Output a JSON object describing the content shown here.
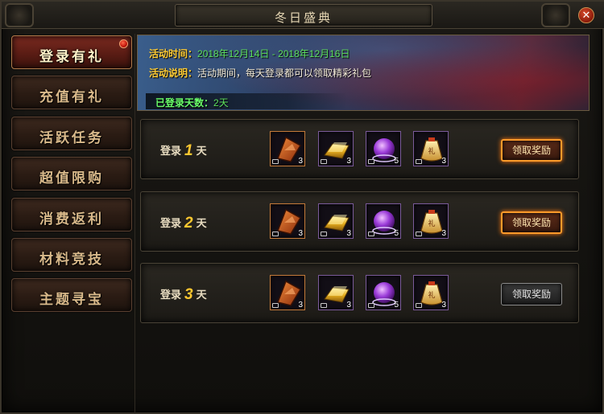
{
  "window": {
    "title": "冬日盛典"
  },
  "sidebar": {
    "items": [
      {
        "label": "登录有礼",
        "active": true,
        "badge": true
      },
      {
        "label": "充值有礼",
        "active": false
      },
      {
        "label": "活跃任务",
        "active": false
      },
      {
        "label": "超值限购",
        "active": false
      },
      {
        "label": "消费返利",
        "active": false
      },
      {
        "label": "材料竞技",
        "active": false
      },
      {
        "label": "主题寻宝",
        "active": false
      }
    ]
  },
  "banner": {
    "time_label": "活动时间：",
    "time_value": "2018年12月14日 - 2018年12月16日",
    "desc_label": "活动说明：",
    "desc_value": "活动期间，每天登录都可以领取精彩礼包",
    "days_label": "已登录天数：",
    "days_value": "2天"
  },
  "rewards": [
    {
      "prefix": "登录",
      "day": "1",
      "suffix": "天",
      "items": [
        {
          "icon": "axe-shard-icon",
          "count": "3"
        },
        {
          "icon": "gold-bar-icon",
          "count": "3"
        },
        {
          "icon": "purple-orb-icon",
          "count": "5"
        },
        {
          "icon": "gift-bag-icon",
          "count": "3"
        }
      ],
      "button": "领取奖励",
      "claimable": true
    },
    {
      "prefix": "登录",
      "day": "2",
      "suffix": "天",
      "items": [
        {
          "icon": "axe-shard-icon",
          "count": "3"
        },
        {
          "icon": "gold-bar-icon",
          "count": "3"
        },
        {
          "icon": "purple-orb-icon",
          "count": "5"
        },
        {
          "icon": "gift-bag-icon",
          "count": "3"
        }
      ],
      "button": "领取奖励",
      "claimable": true
    },
    {
      "prefix": "登录",
      "day": "3",
      "suffix": "天",
      "items": [
        {
          "icon": "axe-shard-icon",
          "count": "3"
        },
        {
          "icon": "gold-bar-icon",
          "count": "3"
        },
        {
          "icon": "purple-orb-icon",
          "count": "5"
        },
        {
          "icon": "gift-bag-icon",
          "count": "3"
        }
      ],
      "button": "领取奖励",
      "claimable": false
    }
  ],
  "colors": {
    "accent_gold": "#ffc830",
    "label_yellow": "#ffcc33",
    "value_green": "#5de05d",
    "claim_glow": "#ff9a2a"
  }
}
